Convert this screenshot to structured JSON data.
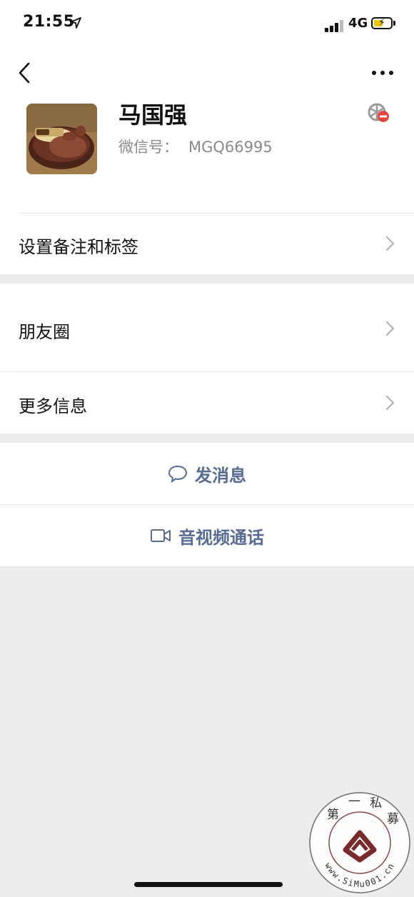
{
  "status_bar": {
    "time": "21:55",
    "network": "4G"
  },
  "profile": {
    "name": "马国强",
    "wechat_id_label": "微信号：",
    "wechat_id": "MGQ66995"
  },
  "menu": {
    "remarks_tags": "设置备注和标签",
    "moments": "朋友圈",
    "more_info": "更多信息"
  },
  "actions": {
    "send_message": "发消息",
    "video_call": "音视频通话"
  },
  "watermark": {
    "chars": [
      "第",
      "一",
      "私",
      "募"
    ],
    "url": "www.SiMu001.cn"
  },
  "colors": {
    "link": "#576b95",
    "background": "#ededed"
  }
}
